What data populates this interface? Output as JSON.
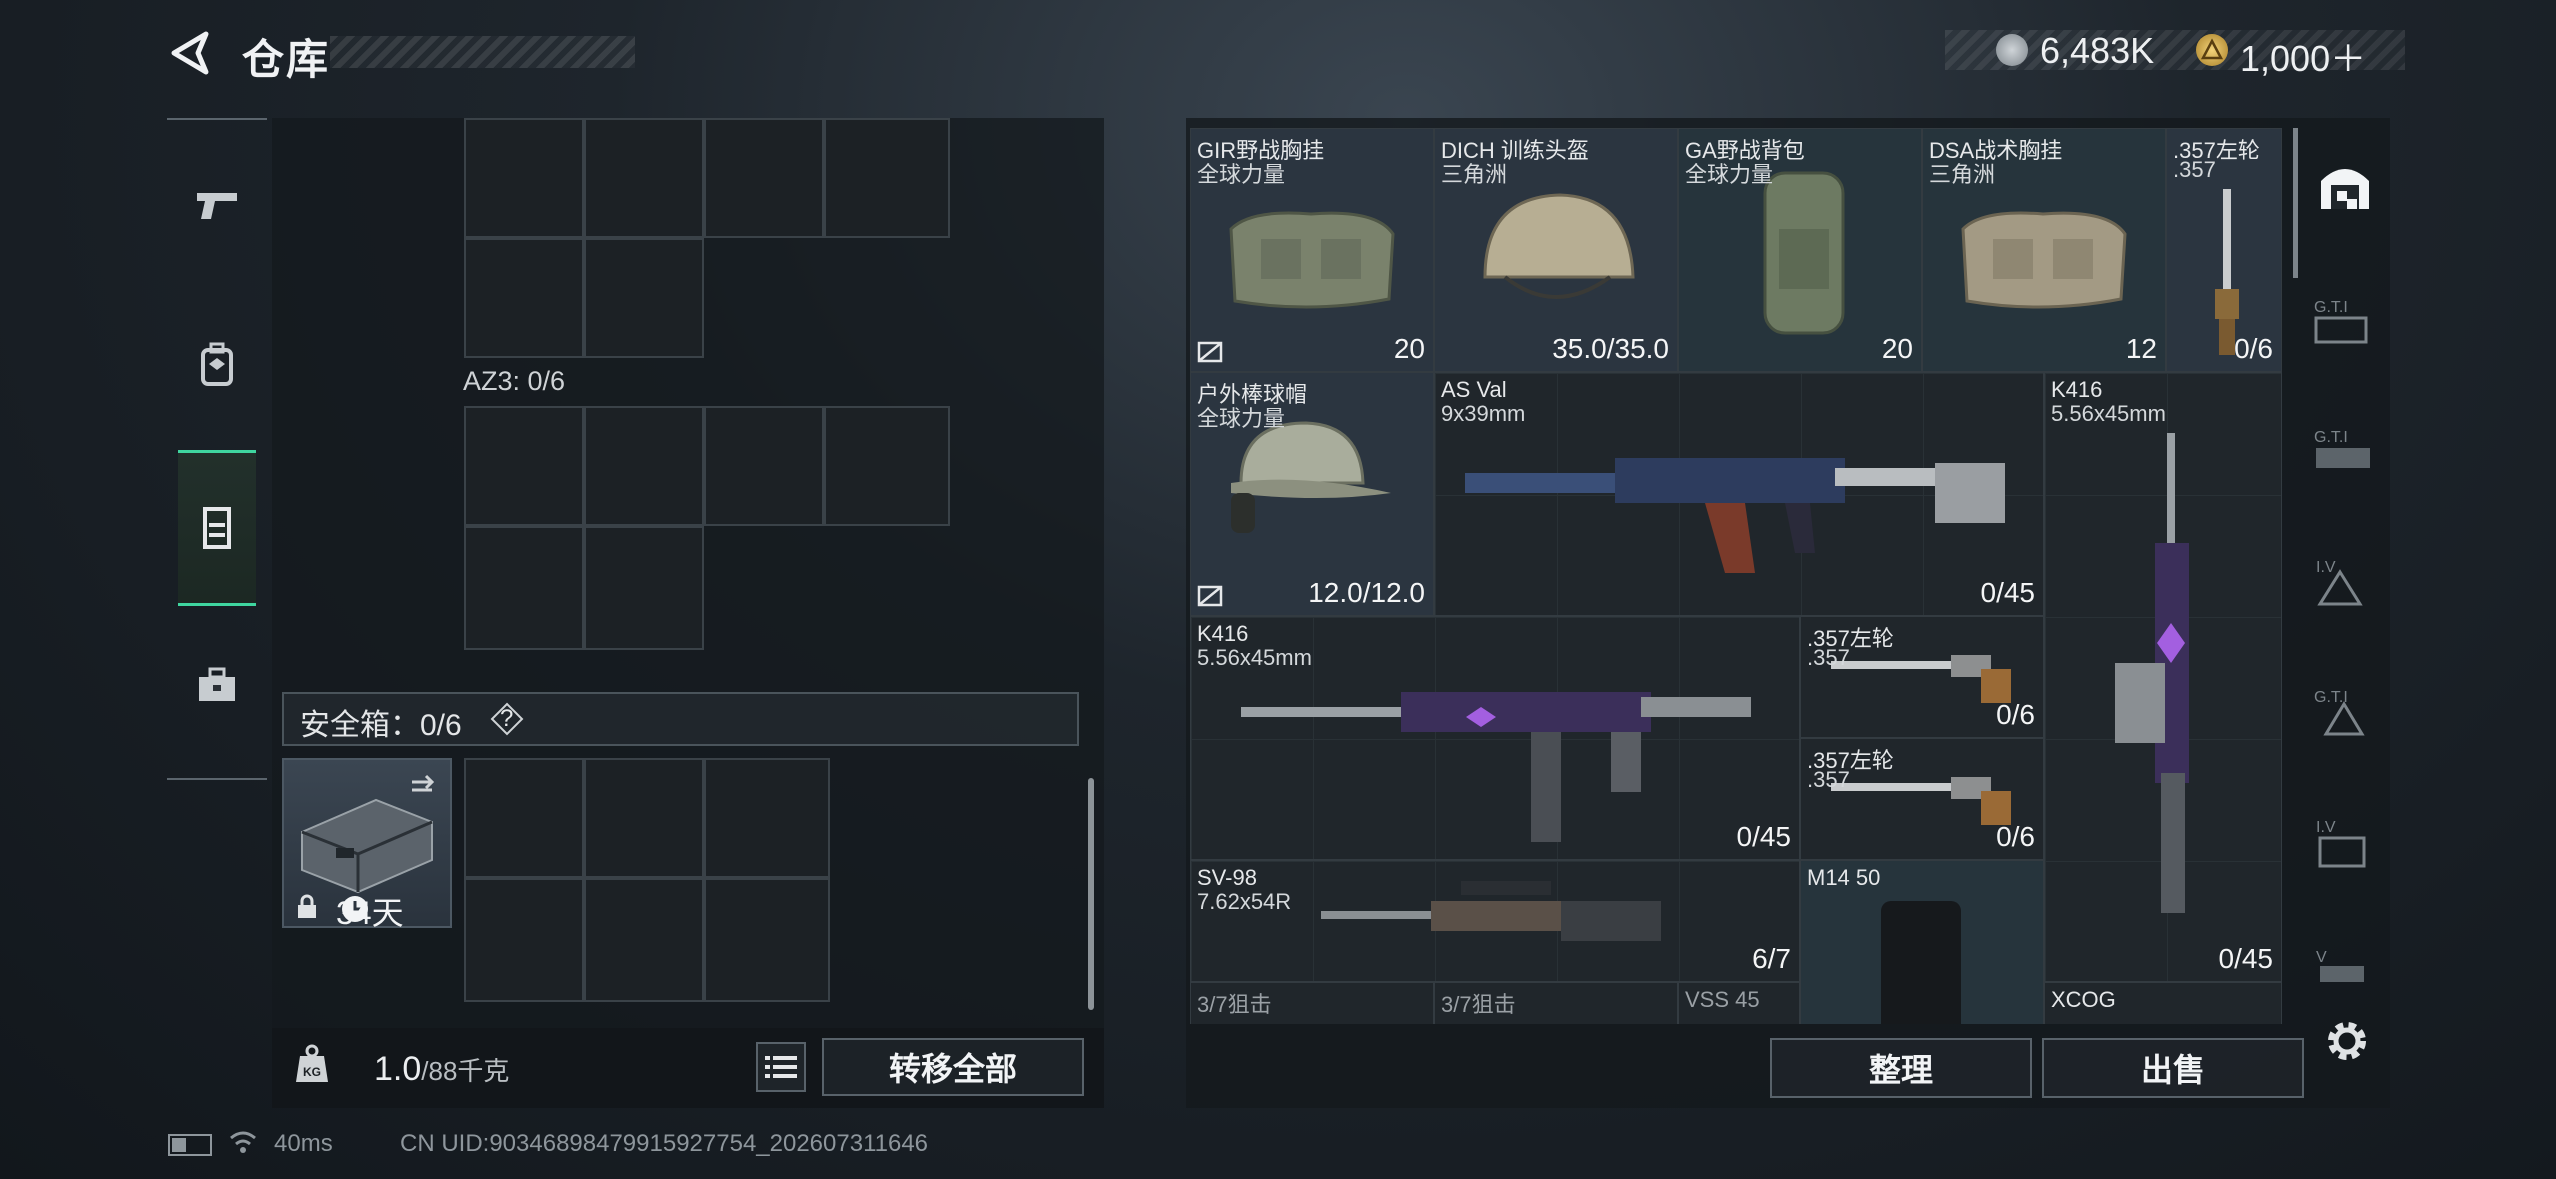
{
  "header": {
    "title": "仓库",
    "currency": [
      {
        "icon": "silver-coin-icon",
        "value": "6,483K"
      },
      {
        "icon": "gold-triangle-coin-icon",
        "value": "1,000＋"
      }
    ]
  },
  "left_nav": [
    {
      "icon": "pistol-icon",
      "active": false
    },
    {
      "icon": "backpack-icon",
      "active": false
    },
    {
      "icon": "rig-icon",
      "active": true
    },
    {
      "icon": "toolbox-icon",
      "active": false
    }
  ],
  "container": {
    "az3_label": "AZ3: 0/6",
    "safe_box_label": "安全箱：0/6",
    "safe_box_help": "?",
    "safe_box_days": "34天",
    "weight_value": "1.0",
    "weight_capacity": "/88千克",
    "transfer_all_label": "转移全部"
  },
  "items": [
    {
      "name": "GIR野战胸挂",
      "sub": "全球力量",
      "value": "20",
      "type": "chest-rig"
    },
    {
      "name": "DICH 训练头盔",
      "sub": "三角洲",
      "value": "35.0/35.0",
      "type": "helmet"
    },
    {
      "name": "GA野战背包",
      "sub": "全球力量",
      "value": "20",
      "type": "backpack"
    },
    {
      "name": "DSA战术胸挂",
      "sub": "三角洲",
      "value": "12",
      "type": "chest-rig"
    },
    {
      "name": ".357左轮",
      "sub": ".357",
      "value": "0/6",
      "type": "revolver-vertical"
    },
    {
      "name": "户外棒球帽",
      "sub": "全球力量",
      "value": "12.0/12.0",
      "type": "cap"
    },
    {
      "name": "AS Val",
      "sub": "9x39mm",
      "value": "0/45",
      "type": "rifle"
    },
    {
      "name": "K416",
      "sub": "5.56x45mm",
      "value": "0/45",
      "type": "rifle-vertical"
    },
    {
      "name": "K416",
      "sub": "5.56x45mm",
      "value": "0/45",
      "type": "rifle"
    },
    {
      "name": ".357左轮",
      "sub": ".357",
      "value": "0/6",
      "type": "revolver"
    },
    {
      "name": ".357左轮",
      "sub": ".357",
      "value": "0/6",
      "type": "revolver"
    },
    {
      "name": "SV-98",
      "sub": "7.62x54R",
      "value": "6/7",
      "type": "sniper"
    },
    {
      "name": "M14 50",
      "sub": "",
      "value": "",
      "type": "magazine"
    },
    {
      "name": "3/7狙击",
      "sub": "",
      "value": "",
      "type": "scope"
    },
    {
      "name": "3/7狙击",
      "sub": "",
      "value": "",
      "type": "scope"
    },
    {
      "name": "VSS 45",
      "sub": "",
      "value": "",
      "type": "magazine"
    },
    {
      "name": "XCOG",
      "sub": "",
      "value": "",
      "type": "scope"
    }
  ],
  "right_nav": [
    "warehouse-icon",
    "gti-tab-1-icon",
    "gti-tab-2-icon",
    "iv-tab-1-icon",
    "gti-tab-3-icon",
    "iv-tab-2-icon",
    "v-tab-icon"
  ],
  "actions": {
    "sort_label": "整理",
    "sell_label": "出售"
  },
  "status": {
    "ping": "40ms",
    "uid": "CN UID:90346898479915927754_202607311646"
  },
  "colors": {
    "accent": "#3fd6a0",
    "panel": "#1c2125"
  }
}
